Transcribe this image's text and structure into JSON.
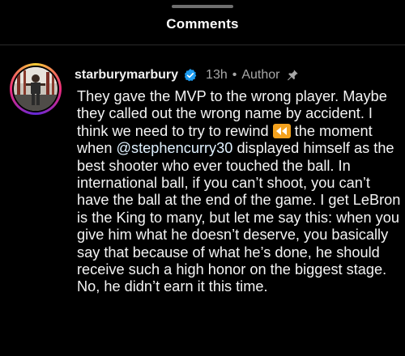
{
  "sheet": {
    "title": "Comments"
  },
  "comment": {
    "username": "starburymarbury",
    "time": "13h",
    "separator": "•",
    "role": "Author",
    "text_part1": "They gave the MVP to the wrong player. Maybe they called out the wrong name by accident. I think we need to try to rewind ",
    "emoji": "rewind-emoji",
    "text_part2": " the moment when ",
    "mention": "@stephencurry30",
    "text_part3": " displayed himself as the best shooter who ever touched the ball. In international ball, if you can’t shoot, you can’t have the ball at the end of the game. I get LeBron is the King to many, but let me say this: when you give him what he doesn’t deserve, you basically say that because of what he’s done, he should receive such a high honor on the biggest stage. No, he didn’t earn it this time."
  },
  "colors": {
    "background": "#000000",
    "verified_badge": "#1d9bf0",
    "meta_text": "#a8a8a8",
    "emoji_bg": "#f4a21e"
  },
  "icons": [
    "verified-badge-icon",
    "pin-icon",
    "rewind-emoji"
  ]
}
